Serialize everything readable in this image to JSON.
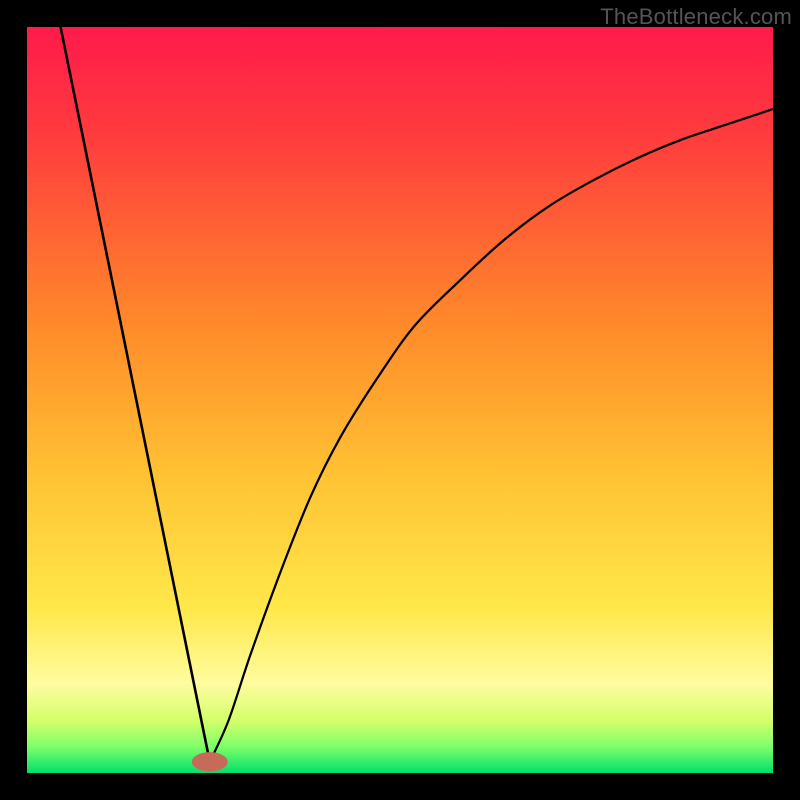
{
  "watermark": "TheBottleneck.com",
  "chart_data": {
    "type": "line",
    "title": "",
    "xlabel": "",
    "ylabel": "",
    "xlim": [
      0,
      100
    ],
    "ylim": [
      0,
      100
    ],
    "gradient_stops": [
      {
        "offset": 0.0,
        "color": "#ff1a4b"
      },
      {
        "offset": 0.15,
        "color": "#ff3d3d"
      },
      {
        "offset": 0.4,
        "color": "#ff8a2a"
      },
      {
        "offset": 0.6,
        "color": "#ffc233"
      },
      {
        "offset": 0.78,
        "color": "#ffe84a"
      },
      {
        "offset": 0.88,
        "color": "#fffca0"
      },
      {
        "offset": 0.93,
        "color": "#d4ff6a"
      },
      {
        "offset": 0.965,
        "color": "#7dff6a"
      },
      {
        "offset": 1.0,
        "color": "#00e06a"
      }
    ],
    "series": [
      {
        "name": "left-line",
        "x": [
          4.5,
          24.5
        ],
        "y": [
          100,
          1.5
        ]
      },
      {
        "name": "right-curve",
        "x": [
          24.5,
          27,
          30,
          34,
          38,
          42,
          47,
          52,
          58,
          64,
          70,
          76,
          82,
          88,
          94,
          100
        ],
        "y": [
          1.5,
          7,
          16,
          27,
          37,
          45,
          53,
          60,
          66,
          71.5,
          76,
          79.5,
          82.5,
          85,
          87,
          89
        ]
      }
    ],
    "marker": {
      "x": 24.5,
      "y": 1.5,
      "color": "#c76a5a",
      "rx": 2.4,
      "ry": 1.3
    }
  }
}
